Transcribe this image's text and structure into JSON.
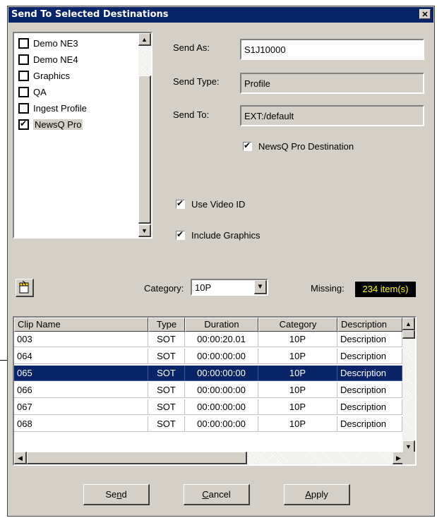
{
  "window": {
    "title": "Send To Selected Destinations",
    "close_glyph": "✕"
  },
  "destinations": [
    {
      "label": "Demo NE3",
      "checked": false,
      "selected": false
    },
    {
      "label": "Demo NE4",
      "checked": false,
      "selected": false
    },
    {
      "label": "Graphics",
      "checked": false,
      "selected": false
    },
    {
      "label": "QA",
      "checked": false,
      "selected": false
    },
    {
      "label": "Ingest Profile",
      "checked": false,
      "selected": false
    },
    {
      "label": "NewsQ Pro",
      "checked": true,
      "selected": true
    }
  ],
  "form": {
    "send_as_label": "Send As:",
    "send_as_value": "S1J10000",
    "send_type_label": "Send Type:",
    "send_type_value": "Profile",
    "send_to_label": "Send To:",
    "send_to_value": "EXT:/default",
    "newsq_dest_label": "NewsQ Pro Destination",
    "use_video_id_label": "Use Video ID",
    "include_graphics_label": "Include Graphics"
  },
  "filters": {
    "category_label": "Category:",
    "category_value": "10P",
    "missing_label": "Missing:",
    "missing_value": "234 item(s)"
  },
  "table": {
    "columns": [
      "Clip Name",
      "Type",
      "Duration",
      "Category",
      "Description"
    ],
    "rows": [
      [
        "003",
        "SOT",
        "00:00:20.01",
        "10P",
        "Description"
      ],
      [
        "064",
        "SOT",
        "00:00:00:00",
        "10P",
        "Description"
      ],
      [
        "065",
        "SOT",
        "00:00:00:00",
        "10P",
        "Description"
      ],
      [
        "066",
        "SOT",
        "00:00:00:00",
        "10P",
        "Description"
      ],
      [
        "067",
        "SOT",
        "00:00:00:00",
        "10P",
        "Description"
      ],
      [
        "068",
        "SOT",
        "00:00:00:00",
        "10P",
        "Description"
      ]
    ],
    "selected_row": 2
  },
  "buttons": {
    "send": {
      "pre": "Se",
      "mnemonic": "n",
      "post": "d"
    },
    "cancel": {
      "pre": "",
      "mnemonic": "C",
      "post": "ancel"
    },
    "apply": {
      "pre": "",
      "mnemonic": "A",
      "post": "pply"
    }
  }
}
